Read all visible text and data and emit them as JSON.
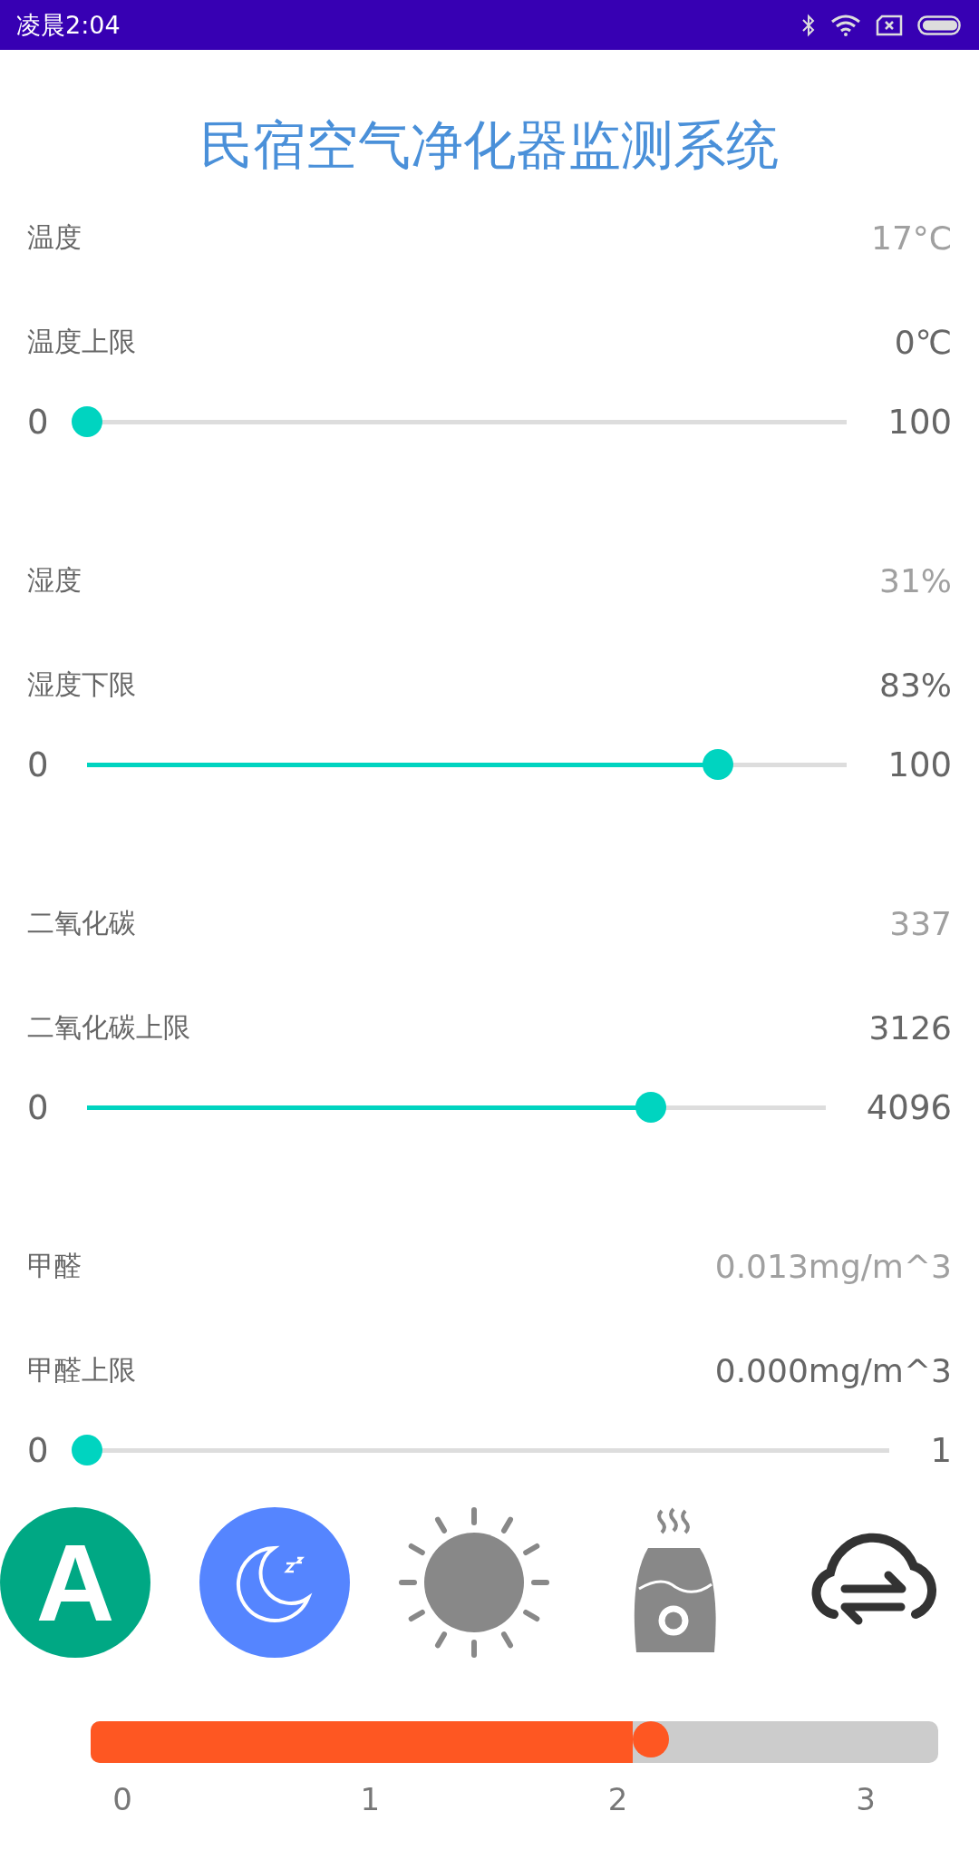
{
  "status_bar": {
    "time": "凌晨2:04"
  },
  "title": "民宿空气净化器监测系统",
  "sections": [
    {
      "label": "温度",
      "reading": "17°C",
      "limit_label": "温度上限",
      "limit_value": "0℃",
      "slider": {
        "min": "0",
        "max": "100",
        "level": 0
      }
    },
    {
      "label": "湿度",
      "reading": "31%",
      "limit_label": "湿度下限",
      "limit_value": "83%",
      "slider": {
        "min": "0",
        "max": "100",
        "level": 0.83
      }
    },
    {
      "label": "二氧化碳",
      "reading": "337",
      "limit_label": "二氧化碳上限",
      "limit_value": "3126",
      "slider": {
        "min": "0",
        "max": "4096",
        "level": 0.763
      }
    },
    {
      "label": "甲醛",
      "reading": "0.013mg/m^3",
      "limit_label": "甲醛上限",
      "limit_value": "0.000mg/m^3",
      "slider": {
        "min": "0",
        "max": "1",
        "level": 0
      }
    }
  ],
  "modes": [
    {
      "kind": "auto",
      "label": "A"
    },
    {
      "kind": "sleep"
    },
    {
      "kind": "sun"
    },
    {
      "kind": "humidifier"
    },
    {
      "kind": "cloud-sync"
    }
  ],
  "speed_slider": {
    "level": 0.668,
    "ticks": [
      "0",
      "1",
      "2",
      "3"
    ]
  }
}
